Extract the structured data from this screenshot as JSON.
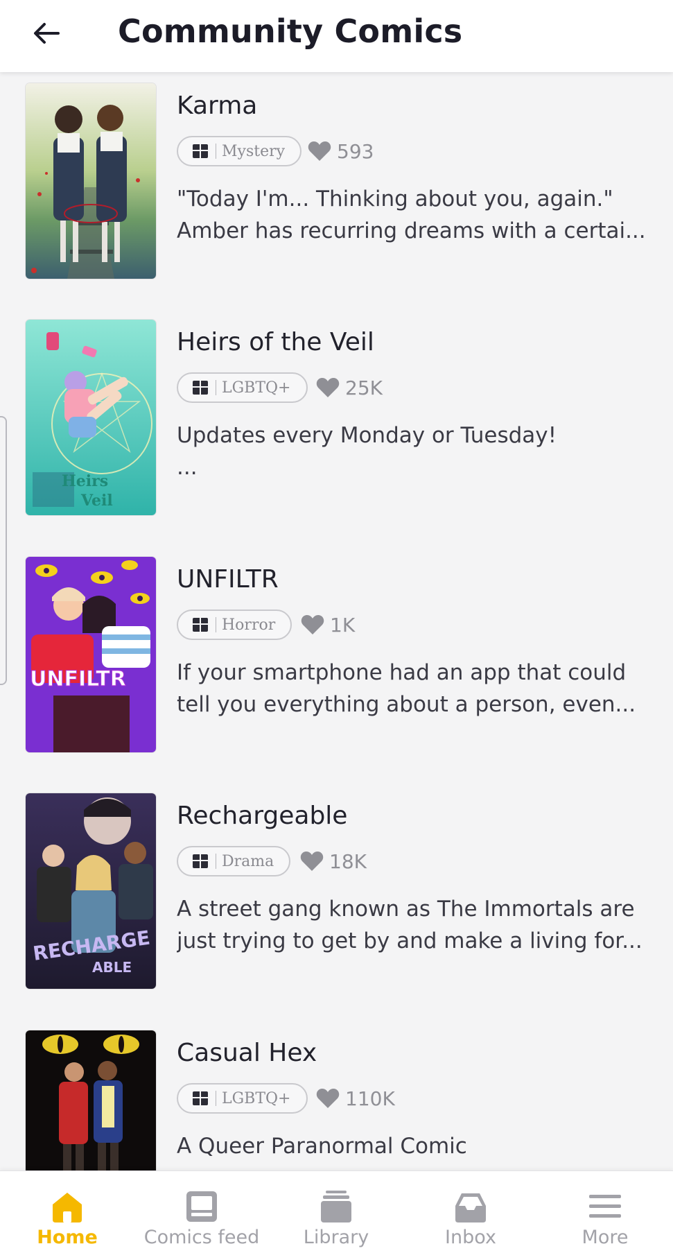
{
  "header": {
    "title": "Community Comics",
    "back_icon": "arrow-left-icon"
  },
  "colors": {
    "accent": "#f5b800",
    "inactive": "#a2a2a8",
    "background": "#f4f4f5"
  },
  "comics": [
    {
      "title": "Karma",
      "genre": "Mystery",
      "likes": "593",
      "description_lines": [
        "\"Today I'm... Thinking about you, again.\"",
        "Amber has recurring dreams with a certai..."
      ]
    },
    {
      "title": "Heirs of the Veil",
      "genre": "LGBTQ+",
      "likes": "25K",
      "description_lines": [
        "Updates every Monday or Tuesday!",
        " ..."
      ]
    },
    {
      "title": "UNFILTR",
      "genre": "Horror",
      "likes": "1K",
      "description_lines": [
        "If your smartphone had an app that could",
        "tell you everything about a person, even..."
      ]
    },
    {
      "title": "Rechargeable",
      "genre": "Drama",
      "likes": "18K",
      "description_lines": [
        "A street gang known as The Immortals are",
        "just trying to get by and make a living for..."
      ]
    },
    {
      "title": "Casual Hex",
      "genre": "LGBTQ+",
      "likes": "110K",
      "description_lines": [
        "A Queer Paranormal Comic",
        ""
      ]
    }
  ],
  "bottom_nav": {
    "items": [
      {
        "label": "Home",
        "icon": "home-icon",
        "active": true
      },
      {
        "label": "Comics feed",
        "icon": "comics-feed-icon",
        "active": false
      },
      {
        "label": "Library",
        "icon": "library-icon",
        "active": false
      },
      {
        "label": "Inbox",
        "icon": "inbox-icon",
        "active": false
      },
      {
        "label": "More",
        "icon": "menu-icon",
        "active": false
      }
    ]
  }
}
